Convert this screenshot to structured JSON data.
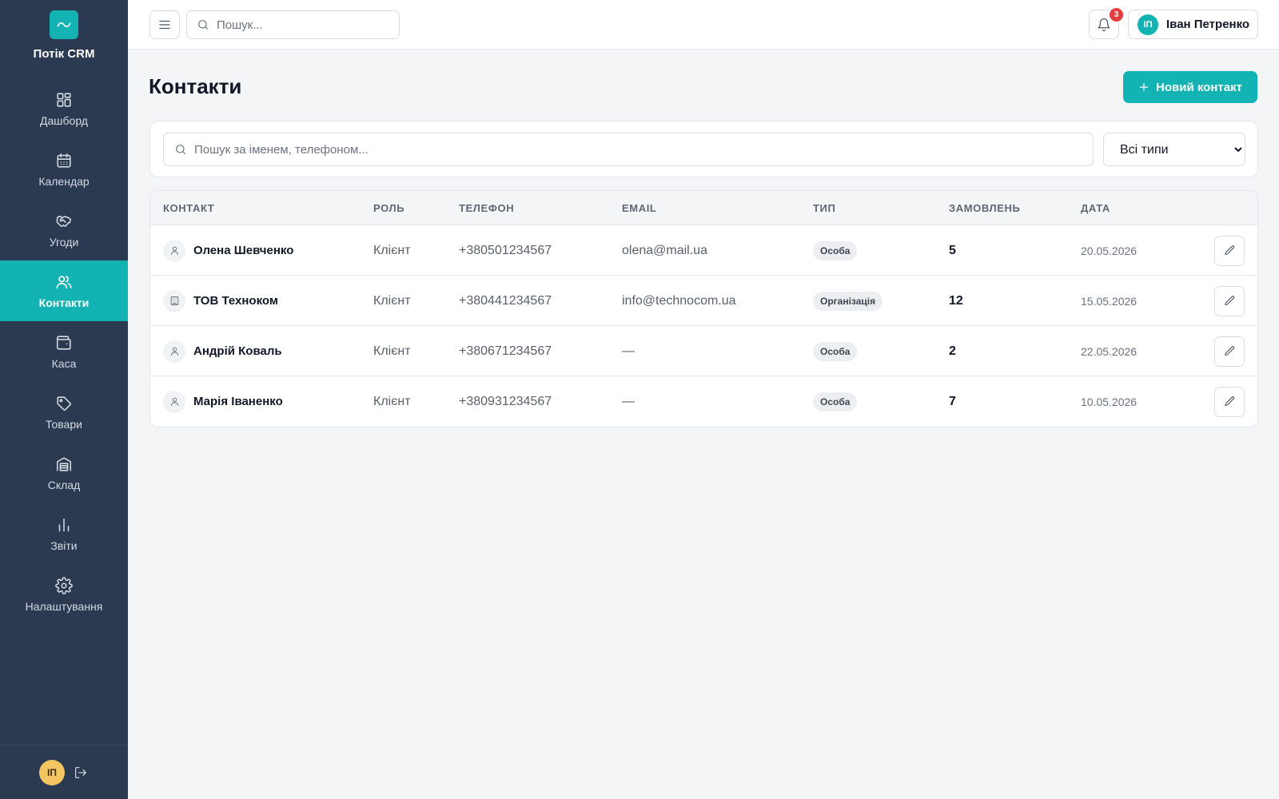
{
  "app": {
    "name": "Потік CRM",
    "accent_color": "#14b3b3",
    "sidebar_color": "#2b3a50"
  },
  "sidebar": {
    "items": [
      {
        "label": "Дашборд",
        "icon": "dashboard-icon",
        "active": false
      },
      {
        "label": "Календар",
        "icon": "calendar-icon",
        "active": false
      },
      {
        "label": "Угоди",
        "icon": "handshake-icon",
        "active": false
      },
      {
        "label": "Контакти",
        "icon": "users-icon",
        "active": true
      },
      {
        "label": "Каса",
        "icon": "wallet-icon",
        "active": false
      },
      {
        "label": "Товари",
        "icon": "tag-icon",
        "active": false
      },
      {
        "label": "Склад",
        "icon": "warehouse-icon",
        "active": false
      },
      {
        "label": "Звіти",
        "icon": "bar-chart-icon",
        "active": false
      },
      {
        "label": "Налаштування",
        "icon": "gear-icon",
        "active": false
      }
    ],
    "footer": {
      "avatar_initials": "ІП"
    }
  },
  "header": {
    "search_placeholder": "Пошук...",
    "notifications_count": "3",
    "user": {
      "initials": "ІП",
      "name": "Іван Петренко"
    }
  },
  "page": {
    "title": "Контакти",
    "new_button_label": "Новий контакт"
  },
  "filters": {
    "search_placeholder": "Пошук за іменем, телефоном...",
    "type_selected": "Всі типи"
  },
  "table": {
    "columns": [
      "Контакт",
      "Роль",
      "Телефон",
      "Email",
      "Тип",
      "Замовлень",
      "Дата"
    ],
    "rows": [
      {
        "kind": "person",
        "name": "Олена Шевченко",
        "role": "Клієнт",
        "phone": "+380501234567",
        "email": "olena@mail.ua",
        "type": "Особа",
        "orders": "5",
        "date": "20.05.2026"
      },
      {
        "kind": "organization",
        "name": "ТОВ Техноком",
        "role": "Клієнт",
        "phone": "+380441234567",
        "email": "info@technocom.ua",
        "type": "Організація",
        "orders": "12",
        "date": "15.05.2026"
      },
      {
        "kind": "person",
        "name": "Андрій Коваль",
        "role": "Клієнт",
        "phone": "+380671234567",
        "email": "—",
        "type": "Особа",
        "orders": "2",
        "date": "22.05.2026"
      },
      {
        "kind": "person",
        "name": "Марія Іваненко",
        "role": "Клієнт",
        "phone": "+380931234567",
        "email": "—",
        "type": "Особа",
        "orders": "7",
        "date": "10.05.2026"
      }
    ]
  }
}
